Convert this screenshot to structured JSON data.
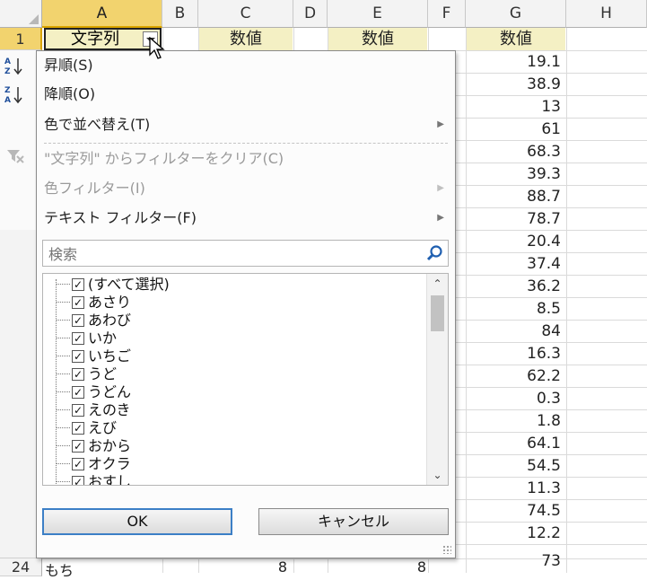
{
  "columns": [
    "A",
    "B",
    "C",
    "D",
    "E",
    "F",
    "G",
    "H"
  ],
  "rows": [
    "1",
    "24"
  ],
  "header_row": {
    "a1": "文字列",
    "c1": "数値",
    "e1": "数値",
    "g1": "数値"
  },
  "g_values": [
    "19.1",
    "38.9",
    "13",
    "61",
    "68.3",
    "39.3",
    "88.7",
    "78.7",
    "20.4",
    "37.4",
    "36.2",
    "8.5",
    "84",
    "16.3",
    "62.2",
    "0.3",
    "1.8",
    "64.1",
    "54.5",
    "11.3",
    "74.5",
    "12.2",
    "73"
  ],
  "row24": {
    "a": "もち",
    "c": "8",
    "e": "8"
  },
  "menu": {
    "sort_asc": "昇順(S)",
    "sort_desc": "降順(O)",
    "sort_color": "色で並べ替え(T)",
    "clear_filter": "\"文字列\" からフィルターをクリア(C)",
    "color_filter": "色フィルター(I)",
    "text_filter": "テキスト フィルター(F)"
  },
  "search": {
    "placeholder": "検索"
  },
  "list_items": [
    "(すべて選択)",
    "あさり",
    "あわび",
    "いか",
    "いちご",
    "うど",
    "うどん",
    "えのき",
    "えび",
    "おから",
    "オクラ",
    "おすし"
  ],
  "buttons": {
    "ok": "OK",
    "cancel": "キャンセル"
  },
  "colors": {
    "selected_header": "#f2d36e",
    "header_fill": "#f4f0c4",
    "ok_border": "#3c7fc6"
  }
}
